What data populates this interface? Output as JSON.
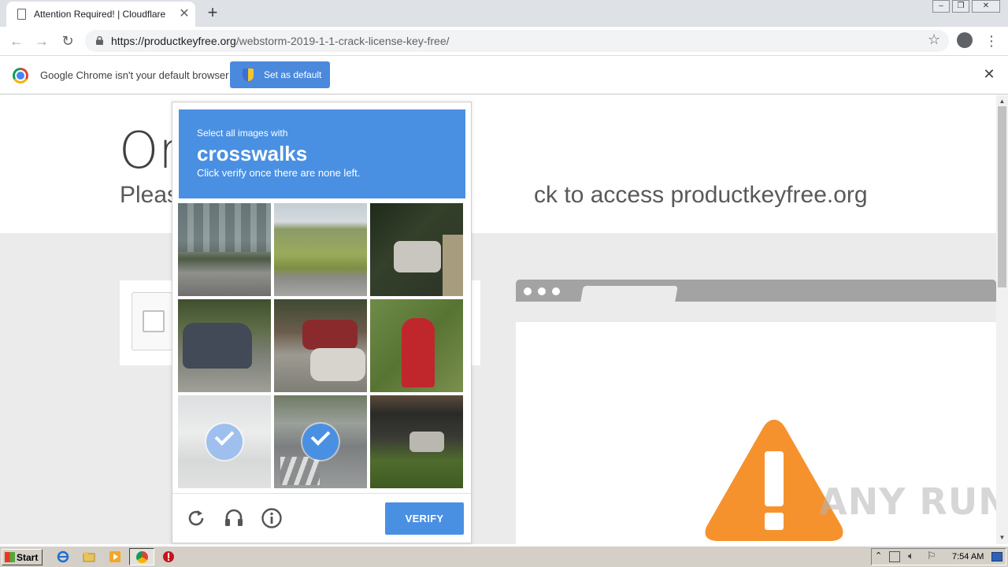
{
  "browser": {
    "tab_title": "Attention Required! | Cloudflare",
    "url_host": "https://productkeyfree.org",
    "url_path": "/webstorm-2019-1-1-crack-license-key-free/"
  },
  "infobar": {
    "message": "Google Chrome isn't your default browser",
    "set_default_label": "Set as default"
  },
  "page": {
    "heading_visible": "On",
    "subheading_left": "Pleas",
    "subheading_right": "ck to access productkeyfree.org"
  },
  "challenge": {
    "line1": "Select all images with",
    "keyword": "crosswalks",
    "line2": "Click verify once there are none left.",
    "tiles": [
      {
        "content": "storefront street corner",
        "selected": false
      },
      {
        "content": "grassy field roadside",
        "selected": false
      },
      {
        "content": "white car at night",
        "selected": false
      },
      {
        "content": "dark sedan parked",
        "selected": false
      },
      {
        "content": "cars on street",
        "selected": false
      },
      {
        "content": "red fire hydrant",
        "selected": false
      },
      {
        "content": "faded street crosswalk",
        "selected": true
      },
      {
        "content": "intersection crosswalk",
        "selected": true
      },
      {
        "content": "building with bushes",
        "selected": false
      }
    ],
    "verify_label": "VERIFY"
  },
  "watermark": "ANY RUN",
  "taskbar": {
    "start_label": "Start",
    "clock": "7:54 AM"
  },
  "colors": {
    "challenge_blue": "#4a90e2",
    "infobar_button": "#4a89dc",
    "warning_orange": "#f6922e"
  }
}
